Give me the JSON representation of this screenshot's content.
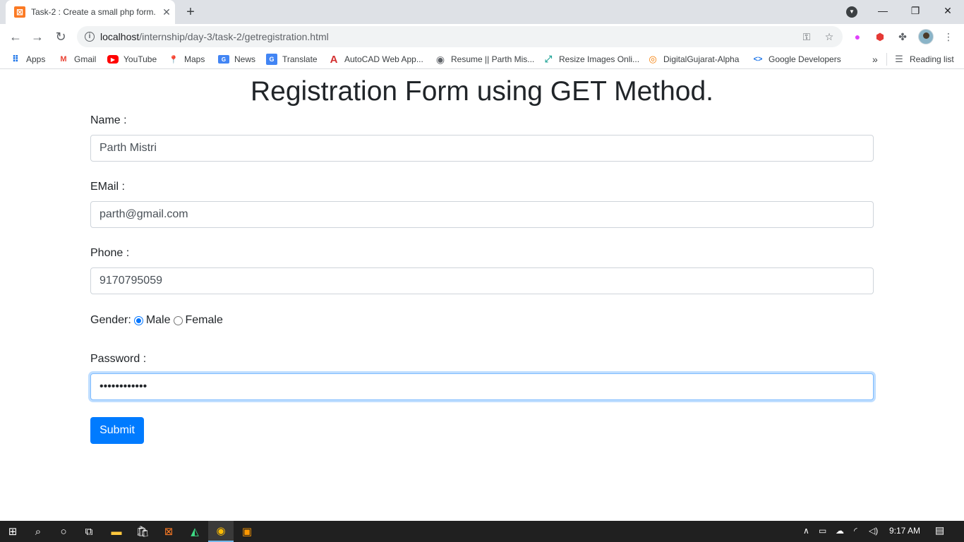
{
  "browser": {
    "tab": {
      "title": "Task-2 : Create a small php form.",
      "favicon": "xampp-icon"
    },
    "new_tab_label": "+",
    "url_host": "localhost",
    "url_path": "/internship/day-3/task-2/getregistration.html",
    "bookmarks": [
      {
        "label": "Apps",
        "icon": "apps-grid-icon"
      },
      {
        "label": "Gmail",
        "icon": "gmail-icon"
      },
      {
        "label": "YouTube",
        "icon": "youtube-icon"
      },
      {
        "label": "Maps",
        "icon": "maps-icon"
      },
      {
        "label": "News",
        "icon": "news-icon"
      },
      {
        "label": "Translate",
        "icon": "translate-icon"
      },
      {
        "label": "AutoCAD Web App...",
        "icon": "autocad-icon"
      },
      {
        "label": "Resume || Parth Mis...",
        "icon": "globe-icon"
      },
      {
        "label": "Resize Images Onli...",
        "icon": "resize-icon"
      },
      {
        "label": "DigitalGujarat-Alpha",
        "icon": "digitalgujarat-icon"
      },
      {
        "label": "Google Developers",
        "icon": "code-icon"
      }
    ],
    "more_bookmarks": "»",
    "reading_list": "Reading list"
  },
  "form": {
    "heading": "Registration Form using GET Method.",
    "name_label": "Name :",
    "name_value": "Parth Mistri",
    "email_label": "EMail :",
    "email_value": "parth@gmail.com",
    "phone_label": "Phone :",
    "phone_value": "9170795059",
    "gender_label": "Gender:",
    "gender_options": [
      "Male",
      "Female"
    ],
    "gender_selected": "Male",
    "password_label": "Password :",
    "password_value": "••••••••••••",
    "submit_label": "Submit"
  },
  "taskbar": {
    "time": "9:17 AM"
  },
  "colors": {
    "primary": "#007bff",
    "tab_strip": "#dee1e6",
    "taskbar": "#202020"
  }
}
